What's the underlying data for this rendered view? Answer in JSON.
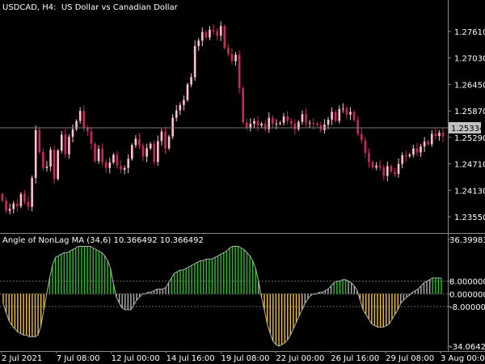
{
  "header": {
    "main": "USDCAD, H4:  US Dollar vs Canadian Dollar",
    "indicator": "Angle of NonLag MA (34,6) 10.366492 10.366492"
  },
  "colors": {
    "background": "#000000",
    "bull_candle": "#ffc0cb",
    "bear_candle": "#c8285f",
    "current_price_line": "#7a7a7a",
    "current_price_badge": "#c0c0c0",
    "up_bars": "#22c422",
    "down_bars": "#f4c430",
    "neutral_bars": "#b4b4b4",
    "level_lines": "#6a6a6a",
    "axis": "#8a8a8a"
  },
  "chart_data": [
    {
      "type": "candlestick",
      "symbol": "USDCAD",
      "timeframe": "H4",
      "title": "USDCAD, H4:  US Dollar vs Canadian Dollar",
      "y_ticks": [
        "1.27610",
        "1.27030",
        "1.26450",
        "1.25870",
        "1.25290",
        "1.24710",
        "1.24130",
        "1.23550"
      ],
      "ylim": [
        1.23196,
        1.28301
      ],
      "current_price": "1.25334",
      "closes": [
        1.239,
        1.2368,
        1.2372,
        1.2384,
        1.2378,
        1.2405,
        1.2388,
        1.2377,
        1.244,
        1.2545,
        1.2497,
        1.2462,
        1.2465,
        1.2502,
        1.2438,
        1.25,
        1.2535,
        1.2492,
        1.253,
        1.2547,
        1.2565,
        1.2587,
        1.255,
        1.2542,
        1.2515,
        1.2477,
        1.2504,
        1.2475,
        1.2462,
        1.2474,
        1.2491,
        1.2467,
        1.2458,
        1.2462,
        1.2482,
        1.2512,
        1.2526,
        1.2511,
        1.2487,
        1.2505,
        1.2515,
        1.2475,
        1.2521,
        1.2542,
        1.2505,
        1.2531,
        1.2572,
        1.2588,
        1.26,
        1.2611,
        1.2645,
        1.2661,
        1.2729,
        1.2741,
        1.276,
        1.2748,
        1.2765,
        1.2762,
        1.2752,
        1.2773,
        1.2725,
        1.2712,
        1.2696,
        1.271,
        1.2637,
        1.2562,
        1.255,
        1.2559,
        1.2565,
        1.2555,
        1.2559,
        1.2547,
        1.2572,
        1.2559,
        1.2559,
        1.2561,
        1.2575,
        1.2565,
        1.2559,
        1.2547,
        1.2563,
        1.258,
        1.2561,
        1.2561,
        1.2559,
        1.2556,
        1.2545,
        1.2557,
        1.2568,
        1.2585,
        1.2565,
        1.2591,
        1.2592,
        1.2579,
        1.2585,
        1.2567,
        1.2537,
        1.2523,
        1.2495,
        1.2475,
        1.2463,
        1.2467,
        1.2463,
        1.2445,
        1.2466,
        1.2454,
        1.2449,
        1.2471,
        1.249,
        1.2488,
        1.2491,
        1.2505,
        1.2496,
        1.2509,
        1.252,
        1.2514,
        1.2537,
        1.2532,
        1.2539,
        1.2531
      ]
    },
    {
      "type": "bar",
      "name": "Angle of NonLag MA (34,6)",
      "title": "Angle of NonLag MA (34,6) 10.366492 10.366492",
      "y_ticks": [
        "36.399836",
        "8.000000",
        "0.000000",
        "-8.000000",
        "-34.064231"
      ],
      "ylim": [
        -34.064231,
        36.399836
      ],
      "levels": [
        8,
        0,
        -8
      ],
      "values": [
        -6,
        -12,
        -17,
        -20,
        -22,
        -24,
        -25,
        -26,
        -26,
        -27,
        -27,
        -27,
        -26,
        -20,
        -10,
        0,
        10,
        18,
        23,
        24,
        25,
        26,
        26,
        27,
        28,
        29,
        30,
        30,
        30,
        30,
        30,
        29,
        28,
        27,
        26,
        24,
        21,
        16,
        6,
        -2,
        -6,
        -9,
        -10,
        -10,
        -10,
        -7,
        -4,
        -2,
        0,
        0,
        1,
        1,
        2,
        3,
        3,
        3,
        4,
        7,
        10,
        13,
        14,
        15,
        15,
        16,
        17,
        18,
        19,
        20,
        21,
        21,
        22,
        22,
        22,
        23,
        24,
        25,
        26,
        27,
        29,
        30,
        30,
        30,
        29,
        28,
        26,
        24,
        21,
        16,
        8,
        -2,
        -10,
        -19,
        -25,
        -30,
        -32,
        -33,
        -32,
        -31,
        -29,
        -26,
        -22,
        -18,
        -14,
        -10,
        -6,
        -3,
        -1,
        0,
        0,
        1,
        1,
        2,
        3,
        5,
        7,
        8,
        8,
        9,
        9,
        8,
        7,
        5,
        2,
        -4,
        -10,
        -13,
        -16,
        -19,
        -20,
        -21,
        -21,
        -21,
        -20,
        -19,
        -16,
        -13,
        -10,
        -6,
        -4,
        -2,
        -1,
        1,
        2,
        3,
        5,
        7,
        8,
        9,
        10,
        10,
        10,
        10
      ],
      "colors": [
        "#f4c430",
        "#f4c430",
        "#f4c430",
        "#f4c430",
        "#f4c430",
        "#f4c430",
        "#f4c430",
        "#f4c430",
        "#f4c430",
        "#f4c430",
        "#f4c430",
        "#f4c430",
        "#f4c430",
        "#f4c430",
        "#f4c430",
        "#22c422",
        "#22c422",
        "#22c422",
        "#22c422",
        "#22c422",
        "#22c422",
        "#22c422",
        "#22c422",
        "#22c422",
        "#22c422",
        "#22c422",
        "#22c422",
        "#22c422",
        "#22c422",
        "#22c422",
        "#22c422",
        "#22c422",
        "#22c422",
        "#22c422",
        "#22c422",
        "#22c422",
        "#22c422",
        "#22c422",
        "#22c422",
        "#b4b4b4",
        "#b4b4b4",
        "#b4b4b4",
        "#b4b4b4",
        "#b4b4b4",
        "#b4b4b4",
        "#b4b4b4",
        "#b4b4b4",
        "#b4b4b4",
        "#b4b4b4",
        "#b4b4b4",
        "#b4b4b4",
        "#b4b4b4",
        "#b4b4b4",
        "#b4b4b4",
        "#b4b4b4",
        "#b4b4b4",
        "#b4b4b4",
        "#b4b4b4",
        "#22c422",
        "#22c422",
        "#22c422",
        "#22c422",
        "#22c422",
        "#22c422",
        "#22c422",
        "#22c422",
        "#22c422",
        "#22c422",
        "#22c422",
        "#22c422",
        "#22c422",
        "#22c422",
        "#22c422",
        "#22c422",
        "#22c422",
        "#22c422",
        "#22c422",
        "#22c422",
        "#22c422",
        "#22c422",
        "#22c422",
        "#22c422",
        "#22c422",
        "#22c422",
        "#22c422",
        "#22c422",
        "#22c422",
        "#22c422",
        "#b4b4b4",
        "#f4c430",
        "#f4c430",
        "#f4c430",
        "#f4c430",
        "#f4c430",
        "#f4c430",
        "#f4c430",
        "#f4c430",
        "#f4c430",
        "#f4c430",
        "#f4c430",
        "#f4c430",
        "#f4c430",
        "#f4c430",
        "#f4c430",
        "#b4b4b4",
        "#b4b4b4",
        "#b4b4b4",
        "#b4b4b4",
        "#b4b4b4",
        "#b4b4b4",
        "#b4b4b4",
        "#b4b4b4",
        "#b4b4b4",
        "#b4b4b4",
        "#22c422",
        "#22c422",
        "#22c422",
        "#22c422",
        "#22c422",
        "#b4b4b4",
        "#b4b4b4",
        "#b4b4b4",
        "#b4b4b4",
        "#f4c430",
        "#f4c430",
        "#f4c430",
        "#f4c430",
        "#f4c430",
        "#f4c430",
        "#f4c430",
        "#f4c430",
        "#f4c430",
        "#f4c430",
        "#f4c430",
        "#f4c430",
        "#f4c430",
        "#f4c430",
        "#b4b4b4",
        "#b4b4b4",
        "#b4b4b4",
        "#b4b4b4",
        "#b4b4b4",
        "#b4b4b4",
        "#b4b4b4",
        "#b4b4b4",
        "#b4b4b4",
        "#b4b4b4",
        "#b4b4b4",
        "#22c422",
        "#22c422",
        "#22c422",
        "#22c422",
        "#22c422"
      ]
    }
  ],
  "time_axis": {
    "labels": [
      "2 Jul 2021",
      "7 Jul 08:00",
      "12 Jul 00:00",
      "14 Jul 16:00",
      "19 Jul 08:00",
      "22 Jul 00:00",
      "26 Jul 16:00",
      "29 Jul 08:00",
      "3 Aug 00:00"
    ]
  }
}
